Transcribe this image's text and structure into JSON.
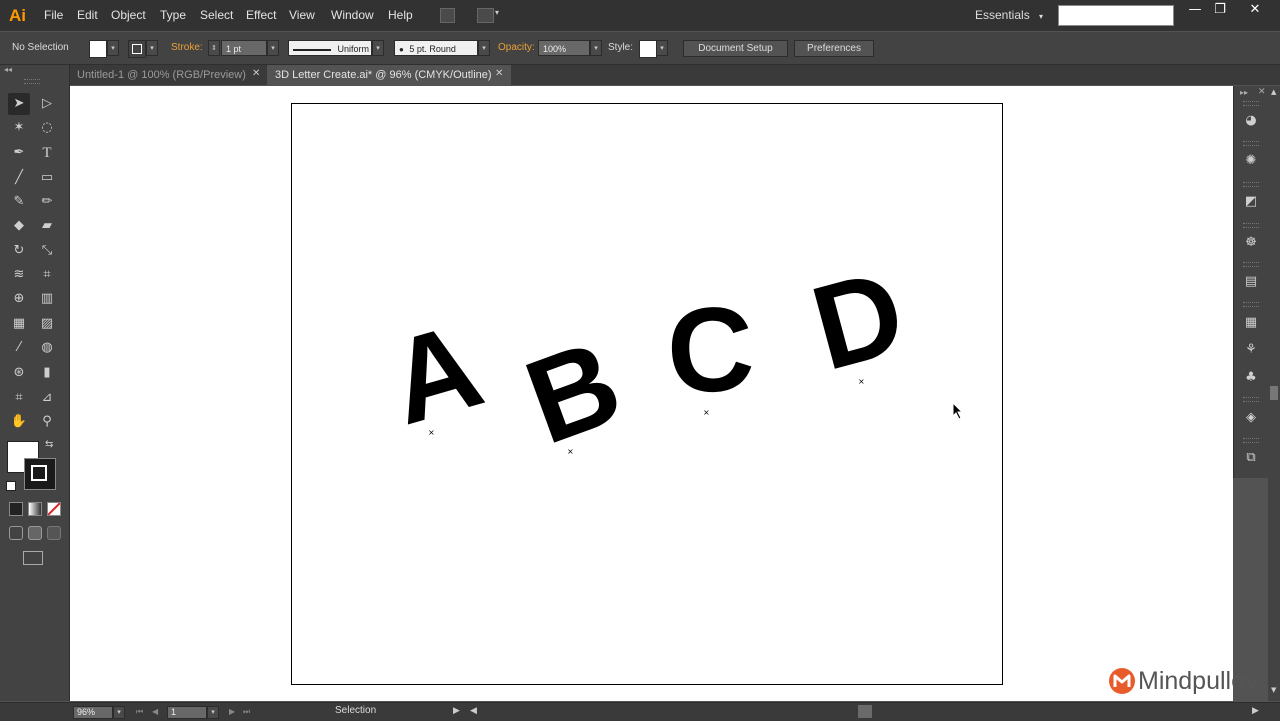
{
  "app": {
    "logo": "Ai"
  },
  "menu": [
    "File",
    "Edit",
    "Object",
    "Type",
    "Select",
    "Effect",
    "View",
    "Window",
    "Help"
  ],
  "workspace": {
    "label": "Essentials",
    "arrow": "▾"
  },
  "window_buttons": {
    "minimize": "—",
    "restore": "❐",
    "close": "✕"
  },
  "control": {
    "selection": "No Selection",
    "stroke_label": "Stroke:",
    "stroke_weight": "1 pt",
    "profile": "Uniform",
    "brush": "5 pt. Round",
    "opacity_label": "Opacity:",
    "opacity": "100%",
    "style_label": "Style:",
    "document_setup": "Document Setup",
    "preferences": "Preferences"
  },
  "tabs": [
    {
      "label": "Untitled-1 @ 100% (RGB/Preview)",
      "active": false
    },
    {
      "label": "3D Letter Create.ai* @ 96% (CMYK/Outline)",
      "active": true
    }
  ],
  "close_glyph": "✕",
  "canvas_letters": [
    "A",
    "B",
    "C",
    "D"
  ],
  "status": {
    "zoom": "96%",
    "artboard": "1",
    "tool": "Selection"
  },
  "watermark": {
    "text": "Mindpulley",
    "color": "#e85c2c"
  },
  "colors": {
    "accent_orange": "#ff9a00",
    "stroke_label_orange": "#e8a13a"
  },
  "icons": {
    "selection-tool": "selection-arrow",
    "direct-selection-tool": "hollow-arrow",
    "magic-wand": "wand",
    "lasso": "lasso",
    "pen": "pen",
    "type": "T",
    "line": "line",
    "rectangle": "rect"
  },
  "tool_glyphs": {
    "selection": "➤",
    "direct": "▷",
    "wand": "✶",
    "lasso": "◌",
    "pen": "✒",
    "type": "T",
    "line": "╱",
    "rect": "▭",
    "brush": "✎",
    "pencil": "✏",
    "blob": "◆",
    "eraser": "▰",
    "rotate": "↻",
    "scale": "⤡",
    "width": "≋",
    "warp": "⌗",
    "shapebuilder": "⊕",
    "persp": "▥",
    "mesh": "▦",
    "gradient": "▨",
    "eyedrop": "⁄",
    "blend": "◍",
    "symbol": "⊛",
    "graph": "▮",
    "artboard": "⌗",
    "slice": "⊿",
    "hand": "✋",
    "zoom": "⚲",
    "swap": "⇆",
    "draw1": "◧",
    "draw2": "◨"
  }
}
